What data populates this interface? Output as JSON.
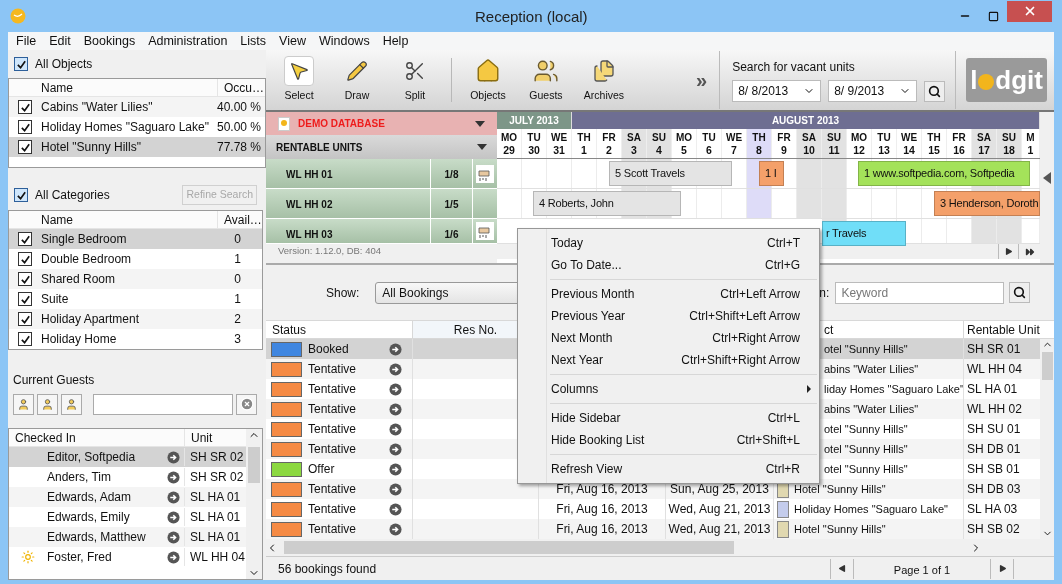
{
  "window": {
    "title": "Reception (local)"
  },
  "menu": [
    "File",
    "Edit",
    "Bookings",
    "Administration",
    "Lists",
    "View",
    "Windows",
    "Help"
  ],
  "objects": {
    "title": "All Objects",
    "all_checked": true,
    "columns": [
      "Name",
      "Occu…"
    ],
    "rows": [
      {
        "name": "Cabins \"Water Lilies\"",
        "value": "40.00 %",
        "checked": true,
        "selected": false
      },
      {
        "name": "Holiday Homes \"Saguaro Lake\"",
        "value": "50.00 %",
        "checked": true,
        "selected": false
      },
      {
        "name": "Hotel \"Sunny Hills\"",
        "value": "77.78 %",
        "checked": true,
        "selected": true
      }
    ]
  },
  "categories": {
    "title": "All Categories",
    "all_checked": true,
    "refine_button": "Refine Search",
    "refine_disabled": true,
    "columns": [
      "Name",
      "Avail…"
    ],
    "rows": [
      {
        "name": "Single Bedroom",
        "value": "0",
        "checked": true,
        "selected": true
      },
      {
        "name": "Double Bedroom",
        "value": "1",
        "checked": true,
        "selected": false
      },
      {
        "name": "Shared Room",
        "value": "0",
        "checked": true,
        "selected": false
      },
      {
        "name": "Suite",
        "value": "1",
        "checked": true,
        "selected": false
      },
      {
        "name": "Holiday Apartment",
        "value": "2",
        "checked": true,
        "selected": false
      },
      {
        "name": "Holiday Home",
        "value": "3",
        "checked": true,
        "selected": false
      }
    ]
  },
  "guests": {
    "title": "Current Guests",
    "columns": [
      "Checked In",
      "Unit"
    ],
    "rows": [
      {
        "name": "Editor, Softpedia",
        "unit": "SH SR 02",
        "selected": true,
        "kind": "plain"
      },
      {
        "name": "Anders, Tim",
        "unit": "SH SR 02",
        "selected": false,
        "kind": "plain"
      },
      {
        "name": "Edwards, Adam",
        "unit": "SL HA 01",
        "selected": false,
        "kind": "plain"
      },
      {
        "name": "Edwards, Emily",
        "unit": "SL HA 01",
        "selected": false,
        "kind": "plain"
      },
      {
        "name": "Edwards, Matthew",
        "unit": "SL HA 01",
        "selected": false,
        "kind": "plain"
      },
      {
        "name": "Foster, Fred",
        "unit": "WL HH 04",
        "selected": false,
        "kind": "new"
      }
    ]
  },
  "toolbar": {
    "tools": [
      {
        "label": "Select",
        "selected": true
      },
      {
        "label": "Draw",
        "selected": false
      },
      {
        "label": "Split",
        "selected": false
      }
    ],
    "views": [
      "Objects",
      "Guests",
      "Archives"
    ],
    "more": "»",
    "search_label": "Search for vacant units",
    "date_from": "8/ 8/2013",
    "date_to": "8/ 9/2013",
    "logo": [
      "l",
      "dgit"
    ]
  },
  "calendar": {
    "database": "DEMO DATABASE",
    "units_header": "RENTABLE UNITS",
    "version": "Version: 1.12.0, DB: 404",
    "units": [
      {
        "name": "WL HH 01",
        "occupancy": "1/8",
        "flag": true
      },
      {
        "name": "WL HH 02",
        "occupancy": "1/5",
        "flag": false
      },
      {
        "name": "WL HH 03",
        "occupancy": "1/6",
        "flag": true
      }
    ],
    "months": [
      "JULY 2013",
      "AUGUST 2013"
    ],
    "days": [
      {
        "dow": "MO",
        "day": "29",
        "weekend": false,
        "today": false
      },
      {
        "dow": "TU",
        "day": "30",
        "weekend": false,
        "today": false
      },
      {
        "dow": "WE",
        "day": "31",
        "weekend": false,
        "today": false
      },
      {
        "dow": "TH",
        "day": "1",
        "weekend": false,
        "today": false
      },
      {
        "dow": "FR",
        "day": "2",
        "weekend": false,
        "today": false
      },
      {
        "dow": "SA",
        "day": "3",
        "weekend": true,
        "today": false
      },
      {
        "dow": "SU",
        "day": "4",
        "weekend": true,
        "today": false
      },
      {
        "dow": "MO",
        "day": "5",
        "weekend": false,
        "today": false
      },
      {
        "dow": "TU",
        "day": "6",
        "weekend": false,
        "today": false
      },
      {
        "dow": "WE",
        "day": "7",
        "weekend": false,
        "today": false
      },
      {
        "dow": "TH",
        "day": "8",
        "weekend": false,
        "today": true
      },
      {
        "dow": "FR",
        "day": "9",
        "weekend": false,
        "today": false
      },
      {
        "dow": "SA",
        "day": "10",
        "weekend": true,
        "today": false
      },
      {
        "dow": "SU",
        "day": "11",
        "weekend": true,
        "today": false
      },
      {
        "dow": "MO",
        "day": "12",
        "weekend": false,
        "today": false
      },
      {
        "dow": "TU",
        "day": "13",
        "weekend": false,
        "today": false
      },
      {
        "dow": "WE",
        "day": "14",
        "weekend": false,
        "today": false
      },
      {
        "dow": "TH",
        "day": "15",
        "weekend": false,
        "today": false
      },
      {
        "dow": "FR",
        "day": "16",
        "weekend": false,
        "today": false
      },
      {
        "dow": "SA",
        "day": "17",
        "weekend": true,
        "today": false
      },
      {
        "dow": "SU",
        "day": "18",
        "weekend": true,
        "today": false
      },
      {
        "dow": "M",
        "day": "1",
        "weekend": false,
        "today": false
      }
    ],
    "rows": [
      {
        "bookings": [
          {
            "label": "5 Scott Travels",
            "color": "#e4e4e4"
          },
          {
            "label": "1 I",
            "color": "#f4a06a"
          },
          {
            "label": "1 www.softpedia.com, Softpedia",
            "color": "#a4e25a"
          }
        ]
      },
      {
        "bookings": [
          {
            "label": "4 Roberts, John",
            "color": "#e4e4e4"
          },
          {
            "label": "3 Henderson, Doroth",
            "color": "#f4a06a"
          }
        ]
      },
      {
        "bookings": [
          {
            "label": "r Travels",
            "color": "#70def8"
          }
        ]
      }
    ]
  },
  "bookings": {
    "show_label": "Show:",
    "filter": "All Bookings",
    "search_label": "n:",
    "search_placeholder": "Keyword",
    "columns": {
      "status": "Status",
      "res_no": "Res No.",
      "column_5": "ct",
      "unit": "Rentable Unit"
    },
    "rows": [
      {
        "status": "Booked",
        "color": "#3f86e0",
        "object": "otel \"Sunny Hills\"",
        "unit": "SH SR 01",
        "selected": true
      },
      {
        "status": "Tentative",
        "color": "#f58a44",
        "object": "abins \"Water Lilies\"",
        "unit": "WL HH 04",
        "selected": false
      },
      {
        "status": "Tentative",
        "color": "#f58a44",
        "object": "liday Homes \"Saguaro Lake\"",
        "unit": "SL HA 01",
        "selected": false
      },
      {
        "status": "Tentative",
        "color": "#f58a44",
        "object": "abins \"Water Lilies\"",
        "unit": "WL HH 02",
        "selected": false
      },
      {
        "status": "Tentative",
        "color": "#f58a44",
        "object": "otel \"Sunny Hills\"",
        "unit": "SH SU 01",
        "selected": false
      },
      {
        "status": "Tentative",
        "color": "#f58a44",
        "object": "otel \"Sunny Hills\"",
        "unit": "SH DB 01",
        "selected": false
      },
      {
        "status": "Offer",
        "color": "#8cd840",
        "object": "otel \"Sunny Hills\"",
        "unit": "SH SB 01",
        "selected": false
      },
      {
        "status": "Tentative",
        "color": "#f58a44",
        "arrival": "Fri, Aug 16, 2013",
        "departure": "Sun, Aug 25, 2013",
        "object_tag": {
          "color": "#e0d8b0"
        },
        "object": "Hotel \"Sunny Hills\"",
        "unit": "SH DB 03",
        "selected": false
      },
      {
        "status": "Tentative",
        "color": "#f58a44",
        "arrival": "Fri, Aug 16, 2013",
        "departure": "Wed, Aug 21, 2013",
        "object_tag": {
          "color": "#c4ccec"
        },
        "object": "Holiday Homes \"Saguaro Lake\"",
        "unit": "SL HA 03",
        "selected": false
      },
      {
        "status": "Tentative",
        "color": "#f58a44",
        "arrival": "Fri, Aug 16, 2013",
        "departure": "Wed, Aug 21, 2013",
        "object_tag": {
          "color": "#e0d8b0"
        },
        "object": "Hotel \"Sunny Hills\"",
        "unit": "SH SB 02",
        "selected": false
      }
    ],
    "count": "56 bookings found",
    "page": "Page 1 of 1"
  },
  "context_menu": [
    {
      "kind": "item",
      "label": "Today",
      "shortcut": "Ctrl+T"
    },
    {
      "kind": "item",
      "label": "Go To Date...",
      "shortcut": "Ctrl+G"
    },
    {
      "kind": "separator"
    },
    {
      "kind": "item",
      "label": "Previous Month",
      "shortcut": "Ctrl+Left Arrow"
    },
    {
      "kind": "item",
      "label": "Previous Year",
      "shortcut": "Ctrl+Shift+Left Arrow"
    },
    {
      "kind": "item",
      "label": "Next Month",
      "shortcut": "Ctrl+Right Arrow"
    },
    {
      "kind": "item",
      "label": "Next Year",
      "shortcut": "Ctrl+Shift+Right Arrow"
    },
    {
      "kind": "separator"
    },
    {
      "kind": "submenu",
      "label": "Columns"
    },
    {
      "kind": "separator"
    },
    {
      "kind": "item",
      "label": "Hide Sidebar",
      "shortcut": "Ctrl+L"
    },
    {
      "kind": "item",
      "label": "Hide Booking List",
      "shortcut": "Ctrl+Shift+L"
    },
    {
      "kind": "separator"
    },
    {
      "kind": "item",
      "label": "Refresh View",
      "shortcut": "Ctrl+R"
    }
  ]
}
